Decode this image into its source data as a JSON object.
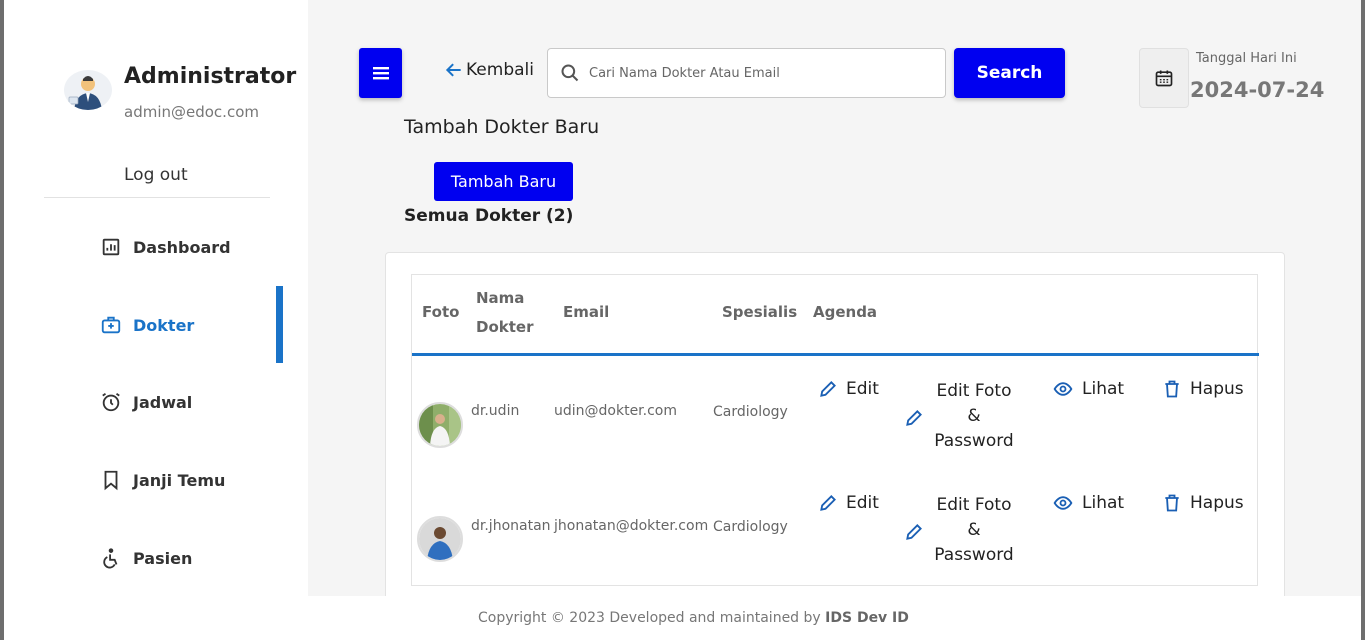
{
  "admin": {
    "name": "Administrator",
    "email": "admin@edoc.com",
    "logout_label": "Log out"
  },
  "nav": [
    {
      "label": "Dashboard",
      "icon": "dashboard-icon"
    },
    {
      "label": "Dokter",
      "icon": "medical-bag-icon",
      "active": true
    },
    {
      "label": "Jadwal",
      "icon": "alarm-clock-icon"
    },
    {
      "label": "Janji Temu",
      "icon": "bookmark-icon"
    },
    {
      "label": "Pasien",
      "icon": "wheelchair-icon"
    }
  ],
  "topbar": {
    "back_label": "Kembali",
    "search_placeholder": "Cari Nama Dokter Atau Email",
    "search_button": "Search",
    "date_label": "Tanggal Hari Ini",
    "date_value": "2024-07-24"
  },
  "main": {
    "add_title": "Tambah Dokter Baru",
    "add_button": "Tambah Baru",
    "all_title": "Semua Dokter (2)"
  },
  "table": {
    "headers": {
      "foto": "Foto",
      "nama_line1": "Nama",
      "nama_line2": "Dokter",
      "email": "Email",
      "spesialis": "Spesialis",
      "agenda": "Agenda"
    },
    "actions": {
      "edit": "Edit",
      "edit_foto_1": "Edit Foto",
      "edit_foto_2": "&",
      "edit_foto_3": "Password",
      "lihat": "Lihat",
      "hapus": "Hapus"
    },
    "rows": [
      {
        "name": "dr.udin",
        "email": "udin@dokter.com",
        "spesialis": "Cardiology"
      },
      {
        "name": "dr.jhonatan",
        "email": "jhonatan@dokter.com",
        "spesialis": "Cardiology"
      }
    ]
  },
  "footer": {
    "text": "Copyright © 2023 Developed and maintained by ",
    "brand": "IDS Dev ID"
  },
  "colors": {
    "primary_button": "#0000f0",
    "active_nav": "#1a73c8",
    "background": "#f5f5f5"
  }
}
